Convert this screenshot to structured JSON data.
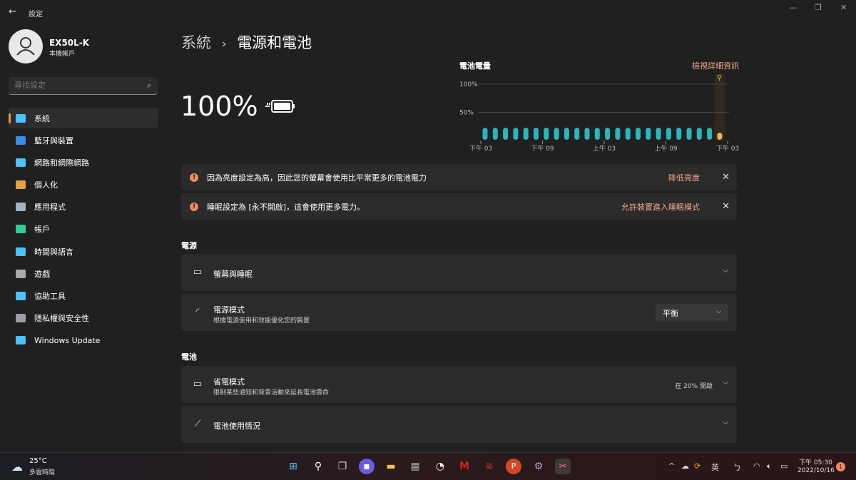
{
  "window": {
    "title": "設定",
    "back_icon": "arrow-left-icon"
  },
  "user": {
    "name": "EX50L-K",
    "type": "本機帳戶"
  },
  "search": {
    "placeholder": "尋找設定"
  },
  "sidebar": {
    "items": [
      {
        "label": "系統",
        "icon": "monitor-icon",
        "color": "#4cc2ff",
        "active": true
      },
      {
        "label": "藍牙與裝置",
        "icon": "bluetooth-icon",
        "color": "#3a8ee6"
      },
      {
        "label": "網路和網際網路",
        "icon": "wifi-icon",
        "color": "#4cc2ff"
      },
      {
        "label": "個人化",
        "icon": "brush-icon",
        "color": "#e6a23c"
      },
      {
        "label": "應用程式",
        "icon": "apps-icon",
        "color": "#a0b4c8"
      },
      {
        "label": "帳戶",
        "icon": "person-icon",
        "color": "#2ecc9a"
      },
      {
        "label": "時間與語言",
        "icon": "globe-clock-icon",
        "color": "#4cc2ff"
      },
      {
        "label": "遊戲",
        "icon": "gamepad-icon",
        "color": "#aaaaaa"
      },
      {
        "label": "協助工具",
        "icon": "accessibility-icon",
        "color": "#4cc2ff"
      },
      {
        "label": "隱私權與安全性",
        "icon": "shield-icon",
        "color": "#9aa0a6"
      },
      {
        "label": "Windows Update",
        "icon": "update-icon",
        "color": "#4cc2ff"
      }
    ]
  },
  "breadcrumb": {
    "parent": "系統",
    "sep": "›",
    "current": "電源和電池"
  },
  "battery": {
    "percent": "100%",
    "icon": "battery-charging-icon"
  },
  "chart_data": {
    "type": "bar",
    "title": "電池電量",
    "link": "檢視詳細資訊",
    "yticks": [
      "100%",
      "50%"
    ],
    "ylim": [
      0,
      100
    ],
    "xticks": [
      "下午 03",
      "下午 09",
      "上午 03",
      "上午 09",
      "下午 03"
    ],
    "values": [
      24,
      24,
      24,
      24,
      24,
      24,
      24,
      24,
      24,
      24,
      24,
      24,
      24,
      24,
      24,
      24,
      24,
      24,
      24,
      24,
      24,
      24,
      24,
      15
    ],
    "colors": {
      "normal": "#2bb5bd",
      "current": "#f0b44c"
    },
    "current_icon": "plug-icon"
  },
  "banners": [
    {
      "text": "因為亮度設定為高，因此您的螢幕會使用比平常更多的電池電力",
      "action": "降低亮度"
    },
    {
      "text": "睡眠設定為 [永不開啟]，這會使用更多電力。",
      "action": "允許裝置進入睡眠模式"
    }
  ],
  "power": {
    "header": "電源",
    "screen_sleep": {
      "title": "螢幕與睡眠"
    },
    "mode": {
      "title": "電源模式",
      "subtitle": "根據電源使用和效能優化您的裝置",
      "value": "平衡"
    }
  },
  "battery_section": {
    "header": "電池",
    "saver": {
      "title": "省電模式",
      "subtitle": "限制某些通知和背景活動來延長電池壽命",
      "status": "在 20% 開啟"
    },
    "usage": {
      "title": "電池使用情況"
    }
  },
  "taskbar": {
    "weather": {
      "temp": "25°C",
      "desc": "多雲時陰"
    },
    "ime": "英",
    "time": "下午 05:30",
    "date": "2022/10/16",
    "notif": "1"
  },
  "accent": "#f08a5d"
}
